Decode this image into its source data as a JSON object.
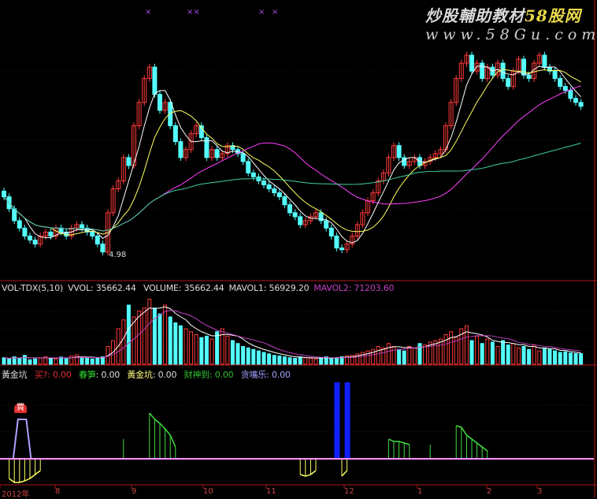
{
  "watermark": {
    "line1_a": "炒股輔助教材",
    "line1_b": "58股网",
    "line2": "www.58Gu.com"
  },
  "price_panel": {
    "low_label": "4.98",
    "markers": [
      "×",
      "××",
      "×",
      "×"
    ]
  },
  "volume_header": {
    "name": "VOL-TDX(5,10)",
    "vvol": "VVOL: 35662.44",
    "volume": "VOLUME: 35662.44",
    "mavol1": "MAVOL1: 56929.20",
    "mavol2": "MAVOL2: 71203.60"
  },
  "indicator_header": {
    "name": "黃金坑",
    "buy_label": "买?",
    "buy_value": ": 0.00",
    "spring_label": "春笋",
    "spring_value": ": 0.00",
    "pit_label": "黃金坑",
    "pit_value": ": 0.00",
    "wealth_label": "财神到",
    "wealth_value": ": 0.00",
    "greed_label": "贪嘴乐",
    "greed_value": ": 0.00"
  },
  "buy_signal_label": "買",
  "x_axis": [
    "2012年",
    "8",
    "9",
    "10",
    "11",
    "12",
    "1",
    "2",
    "3"
  ],
  "colors": {
    "up": "#ff3a3a",
    "down": "#54ffff",
    "ma5": "#ffffff",
    "ma10": "#ffff60",
    "ma30": "#ff40ff",
    "ma60": "#40d0a0",
    "grid": "#7a1010",
    "baseline": "#ff90ff"
  },
  "chart_data": {
    "type": "candlestick",
    "ylim": [
      4.49,
      9.41
    ],
    "close": [
      5.95,
      5.74,
      5.53,
      5.4,
      5.26,
      5.19,
      5.12,
      5.26,
      5.33,
      5.26,
      5.4,
      5.33,
      5.26,
      5.4,
      5.46,
      5.4,
      5.33,
      5.26,
      5.12,
      4.98,
      5.67,
      6.09,
      6.23,
      6.64,
      6.5,
      7.2,
      7.61,
      8.03,
      8.23,
      7.75,
      7.47,
      7.61,
      7.2,
      6.92,
      6.64,
      6.78,
      7.06,
      7.2,
      6.99,
      6.64,
      6.78,
      6.64,
      6.71,
      6.85,
      6.78,
      6.71,
      6.57,
      6.37,
      6.3,
      6.23,
      6.16,
      6.09,
      6.02,
      5.95,
      5.81,
      5.67,
      5.6,
      5.46,
      5.53,
      5.6,
      5.67,
      5.53,
      5.4,
      5.26,
      5.05,
      5.02,
      5.12,
      5.26,
      5.46,
      5.67,
      5.88,
      6.02,
      6.23,
      6.37,
      6.64,
      6.85,
      6.64,
      6.5,
      6.57,
      6.64,
      6.5,
      6.57,
      6.64,
      6.71,
      6.78,
      7.2,
      7.61,
      8.03,
      8.3,
      8.44,
      8.16,
      8.3,
      8.03,
      8.23,
      8.09,
      8.3,
      8.03,
      7.89,
      8.16,
      8.37,
      8.09,
      8.03,
      8.3,
      8.44,
      8.23,
      8.16,
      8.03,
      7.89,
      7.82,
      7.68,
      7.61,
      7.54
    ],
    "volume": [
      22000,
      18000,
      25000,
      20000,
      30000,
      15000,
      18000,
      22000,
      25000,
      20000,
      18000,
      24000,
      20000,
      28000,
      32000,
      20000,
      22000,
      18000,
      20000,
      25000,
      60000,
      80000,
      120000,
      150000,
      200000,
      160000,
      180000,
      190000,
      220000,
      190000,
      170000,
      200000,
      160000,
      140000,
      130000,
      120000,
      110000,
      100000,
      90000,
      95000,
      85000,
      110000,
      120000,
      95000,
      80000,
      70000,
      60000,
      55000,
      50000,
      45000,
      40000,
      35000,
      30000,
      28000,
      25000,
      22000,
      20000,
      25000,
      22000,
      20000,
      18000,
      22000,
      25000,
      20000,
      22000,
      25000,
      28000,
      30000,
      35000,
      40000,
      45000,
      50000,
      60000,
      55000,
      70000,
      60000,
      50000,
      45000,
      60000,
      55000,
      70000,
      65000,
      75000,
      80000,
      85000,
      100000,
      110000,
      90000,
      120000,
      130000,
      80000,
      95000,
      70000,
      85000,
      75000,
      60000,
      80000,
      65000,
      70000,
      55000,
      60000,
      50000,
      65000,
      45000,
      55000,
      50000,
      45000,
      40000,
      42000,
      38000,
      36000,
      35662
    ],
    "volume_ylim": [
      0,
      240000
    ],
    "moving_averages": [
      5,
      10,
      30,
      60
    ],
    "indicator": {
      "green": [
        {
          "start": 23,
          "values": [
            25
          ]
        },
        {
          "start": 28,
          "values": [
            58,
            50,
            45,
            38,
            30,
            15
          ]
        },
        {
          "start": 66,
          "values": [
            30
          ]
        },
        {
          "start": 74,
          "values": [
            25,
            22,
            22,
            20,
            18
          ]
        },
        {
          "start": 82,
          "values": [
            18
          ]
        },
        {
          "start": 87,
          "values": [
            42,
            40,
            30,
            25,
            20,
            15,
            10
          ]
        }
      ],
      "yellow": [
        {
          "start": 1,
          "values": [
            25,
            30,
            30,
            28,
            25,
            20,
            15
          ]
        },
        {
          "start": 57,
          "values": [
            20,
            22,
            20,
            15
          ]
        },
        {
          "start": 65,
          "values": [
            22,
            15
          ]
        }
      ],
      "purple": [
        {
          "start": 3,
          "values": [
            50,
            50
          ]
        }
      ],
      "blue": [
        {
          "index": 64,
          "value": 97
        },
        {
          "index": 66,
          "value": 97
        }
      ]
    }
  }
}
